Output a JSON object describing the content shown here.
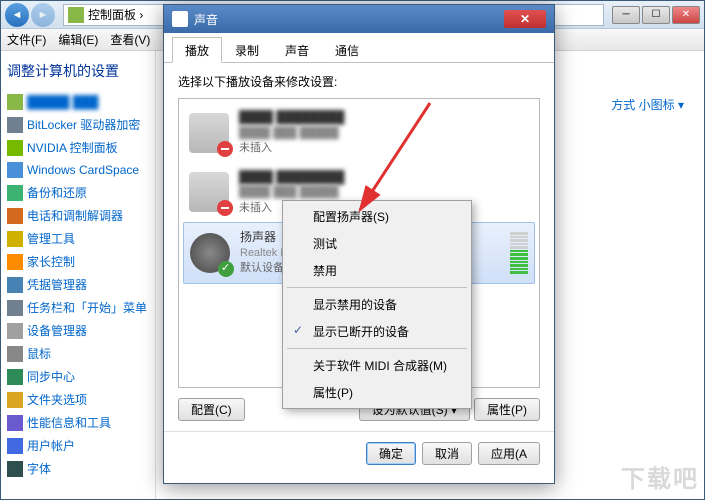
{
  "explorer": {
    "breadcrumb": "控制面板 ›",
    "menubar": [
      "文件(F)",
      "编辑(E)",
      "查看(V)"
    ],
    "heading": "调整计算机的设置",
    "view_label": "方式",
    "view_value": "小图标 ▾",
    "sidebar": [
      {
        "icon": "#8ab848",
        "label": "█████ ███",
        "blur": true
      },
      {
        "icon": "#708090",
        "label": "BitLocker 驱动器加密"
      },
      {
        "icon": "#76b900",
        "label": "NVIDIA 控制面板"
      },
      {
        "icon": "#4a90d9",
        "label": "Windows CardSpace"
      },
      {
        "icon": "#3cb371",
        "label": "备份和还原"
      },
      {
        "icon": "#d2691e",
        "label": "电话和调制解调器"
      },
      {
        "icon": "#d0b000",
        "label": "管理工具"
      },
      {
        "icon": "#ff8c00",
        "label": "家长控制"
      },
      {
        "icon": "#4682b4",
        "label": "凭据管理器"
      },
      {
        "icon": "#708090",
        "label": "任务栏和「开始」菜单"
      },
      {
        "icon": "#a0a0a0",
        "label": "设备管理器"
      },
      {
        "icon": "#888888",
        "label": "鼠标"
      },
      {
        "icon": "#2e8b57",
        "label": "同步中心"
      },
      {
        "icon": "#daa520",
        "label": "文件夹选项"
      },
      {
        "icon": "#6a5acd",
        "label": "性能信息和工具"
      },
      {
        "icon": "#4169e1",
        "label": "用户帐户"
      },
      {
        "icon": "#2f4f4f",
        "label": "字体"
      }
    ]
  },
  "sound_dialog": {
    "title": "声音",
    "tabs": [
      "播放",
      "录制",
      "声音",
      "通信"
    ],
    "active_tab": 0,
    "instruction": "选择以下播放设备来修改设置:",
    "devices": [
      {
        "name": "████ ████████",
        "sub": "████ ███ █████",
        "status": "未插入",
        "badge": "down",
        "icon": "monitor"
      },
      {
        "name": "████ ████████",
        "sub": "████ ███ █████",
        "status": "未插入",
        "badge": "down",
        "icon": "monitor"
      },
      {
        "name": "扬声器",
        "sub": "Realtek H",
        "status": "默认设备",
        "badge": "ok",
        "icon": "speaker",
        "selected": true,
        "vu": true
      }
    ],
    "btn_configure": "配置(C)",
    "btn_default": "设为默认值(S) ▾",
    "btn_properties": "属性(P)",
    "btn_ok": "确定",
    "btn_cancel": "取消",
    "btn_apply": "应用(A"
  },
  "context_menu": {
    "items": [
      {
        "label": "配置扬声器(S)"
      },
      {
        "label": "测试"
      },
      {
        "label": "禁用"
      },
      {
        "sep": true
      },
      {
        "label": "显示禁用的设备"
      },
      {
        "label": "显示已断开的设备",
        "checked": true
      },
      {
        "sep": true
      },
      {
        "label": "关于软件 MIDI 合成器(M)"
      },
      {
        "label": "属性(P)"
      }
    ]
  },
  "watermark": "下载吧"
}
